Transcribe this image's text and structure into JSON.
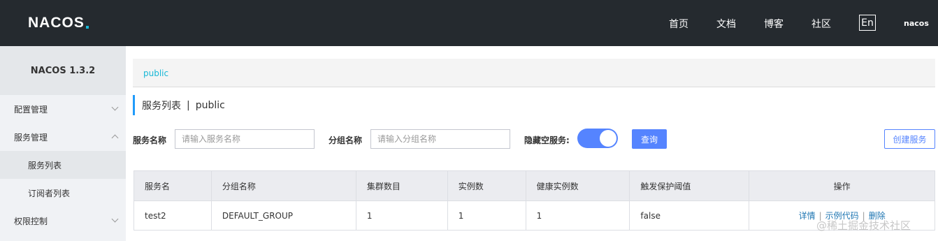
{
  "header": {
    "logo": "NACOS",
    "nav": [
      "首页",
      "文档",
      "博客",
      "社区"
    ],
    "lang": "En",
    "user": "nacos"
  },
  "sidebar": {
    "title": "NACOS 1.3.2",
    "items": [
      {
        "label": "配置管理"
      },
      {
        "label": "服务管理"
      },
      {
        "label": "服务列表"
      },
      {
        "label": "订阅者列表"
      },
      {
        "label": "权限控制"
      }
    ]
  },
  "breadcrumb": "public",
  "page": {
    "title": "服务列表",
    "separator": "|",
    "namespace": "public"
  },
  "filters": {
    "service_label": "服务名称",
    "service_placeholder": "请输入服务名称",
    "group_label": "分组名称",
    "group_placeholder": "请输入分组名称",
    "hide_empty_label": "隐藏空服务:",
    "hide_empty_on": true,
    "query_button": "查询",
    "create_button": "创建服务"
  },
  "table": {
    "columns": [
      "服务名",
      "分组名称",
      "集群数目",
      "实例数",
      "健康实例数",
      "触发保护阈值",
      "操作"
    ],
    "rows": [
      {
        "service": "test2",
        "group": "DEFAULT_GROUP",
        "clusters": "1",
        "instances": "1",
        "healthy": "1",
        "threshold": "false",
        "ops": [
          "详情",
          "示例代码",
          "删除"
        ]
      }
    ]
  },
  "watermark": "@稀土掘金技术社区",
  "colors": {
    "header_bg": "#252a2f",
    "accent": "#5584ff",
    "link": "#17b8d6"
  }
}
